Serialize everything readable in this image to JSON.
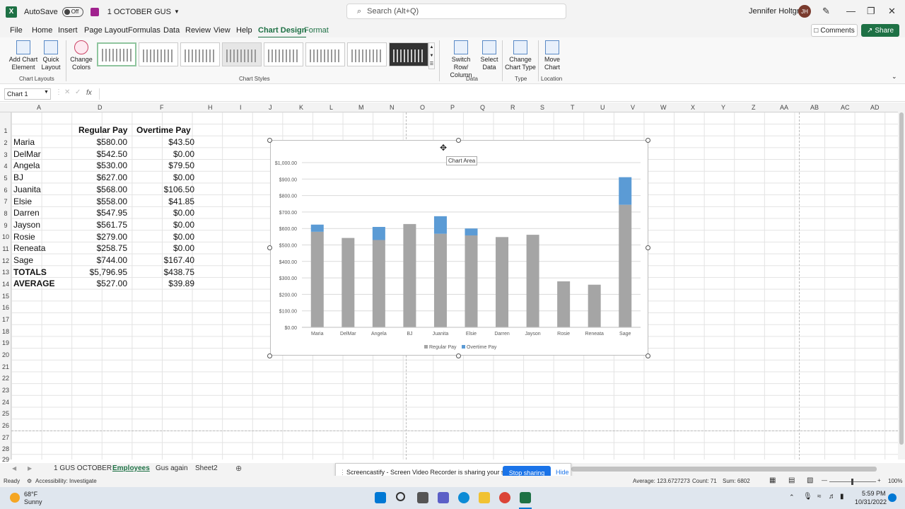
{
  "titlebar": {
    "autosave": "AutoSave",
    "toggle": "Off",
    "filename": "1 OCTOBER GUS",
    "search_placeholder": "Search (Alt+Q)",
    "user": "Jennifer Holtgrew",
    "initials": "JH"
  },
  "menu": [
    "File",
    "Home",
    "Insert",
    "Page Layout",
    "Formulas",
    "Data",
    "Review",
    "View",
    "Help",
    "Chart Design",
    "Format"
  ],
  "actions": {
    "comments": "Comments",
    "share": "Share"
  },
  "ribbon": {
    "add_chart_element": [
      "Add Chart",
      "Element"
    ],
    "quick_layout": [
      "Quick",
      "Layout"
    ],
    "change_colors": [
      "Change",
      "Colors"
    ],
    "switch_row_column": [
      "Switch Row/",
      "Column"
    ],
    "select_data": [
      "Select",
      "Data"
    ],
    "change_chart_type": [
      "Change",
      "Chart Type"
    ],
    "move_chart": [
      "Move",
      "Chart"
    ],
    "groups": {
      "chart_layouts": "Chart Layouts",
      "chart_styles": "Chart Styles",
      "data": "Data",
      "type": "Type",
      "location": "Location"
    }
  },
  "formula_bar": {
    "name_box": "Chart 1",
    "fx": "fx"
  },
  "columns": [
    "A",
    "D",
    "F",
    "H",
    "I",
    "J",
    "K",
    "L",
    "M",
    "N",
    "O",
    "P",
    "Q",
    "R",
    "S",
    "T",
    "U",
    "V",
    "W",
    "X",
    "Y",
    "Z",
    "AA",
    "AB",
    "AC",
    "AD"
  ],
  "rows": [
    "1",
    "2",
    "3",
    "4",
    "5",
    "6",
    "7",
    "8",
    "9",
    "10",
    "11",
    "12",
    "13",
    "14",
    "15",
    "16",
    "17",
    "18",
    "19",
    "20",
    "21",
    "22",
    "23",
    "24",
    "25",
    "26",
    "27",
    "28",
    "29"
  ],
  "sheet": {
    "headers": {
      "regular": "Regular Pay",
      "overtime": "Overtime Pay"
    },
    "employees": [
      {
        "name": "Maria",
        "regular": "$580.00",
        "overtime": "$43.50"
      },
      {
        "name": "DelMar",
        "regular": "$542.50",
        "overtime": "$0.00"
      },
      {
        "name": "Angela",
        "regular": "$530.00",
        "overtime": "$79.50"
      },
      {
        "name": "BJ",
        "regular": "$627.00",
        "overtime": "$0.00"
      },
      {
        "name": "Juanita",
        "regular": "$568.00",
        "overtime": "$106.50"
      },
      {
        "name": "Elsie",
        "regular": "$558.00",
        "overtime": "$41.85"
      },
      {
        "name": "Darren",
        "regular": "$547.95",
        "overtime": "$0.00"
      },
      {
        "name": "Jayson",
        "regular": "$561.75",
        "overtime": "$0.00"
      },
      {
        "name": "Rosie",
        "regular": "$279.00",
        "overtime": "$0.00"
      },
      {
        "name": "Reneata",
        "regular": "$258.75",
        "overtime": "$0.00"
      },
      {
        "name": "Sage",
        "regular": "$744.00",
        "overtime": "$167.40"
      }
    ],
    "totals": {
      "label": "TOTALS",
      "regular": "$5,796.95",
      "overtime": "$438.75"
    },
    "average": {
      "label": "AVERAGE",
      "regular": "$527.00",
      "overtime": "$39.89"
    }
  },
  "chart_tooltip": "Chart Area",
  "chart_data": {
    "type": "bar",
    "stacked": true,
    "categories": [
      "Maria",
      "DelMar",
      "Angela",
      "BJ",
      "Juanita",
      "Elsie",
      "Darren",
      "Jayson",
      "Rosie",
      "Reneata",
      "Sage"
    ],
    "series": [
      {
        "name": "Regular Pay",
        "values": [
          580,
          542.5,
          530,
          627,
          568,
          558,
          547.95,
          561.75,
          279,
          258.75,
          744
        ],
        "color": "#a5a5a5"
      },
      {
        "name": "Overtime Pay",
        "values": [
          43.5,
          0,
          79.5,
          0,
          106.5,
          41.85,
          0,
          0,
          0,
          0,
          167.4
        ],
        "color": "#5b9bd5"
      }
    ],
    "ylim": [
      0,
      1000
    ],
    "yticks": [
      "$0.00",
      "$100.00",
      "$200.00",
      "$300.00",
      "$400.00",
      "$500.00",
      "$600.00",
      "$700.00",
      "$800.00",
      "$900.00",
      "$1,000.00"
    ],
    "legend": "bottom",
    "grid": true
  },
  "sheet_tabs": [
    "1 GUS OCTOBER",
    "Employees",
    "Gus again",
    "Sheet2"
  ],
  "share_notice": {
    "text": "Screencastify - Screen Video Recorder is sharing your screen.",
    "stop": "Stop sharing",
    "hide": "Hide"
  },
  "status": {
    "ready": "Ready",
    "accessibility": "Accessibility: Investigate",
    "average": "Average: 123.6727273",
    "count": "Count: 71",
    "sum": "Sum: 6802",
    "zoom": "100%"
  },
  "taskbar": {
    "temp": "68°F",
    "weather": "Sunny",
    "time": "5:59 PM",
    "date": "10/31/2022"
  }
}
